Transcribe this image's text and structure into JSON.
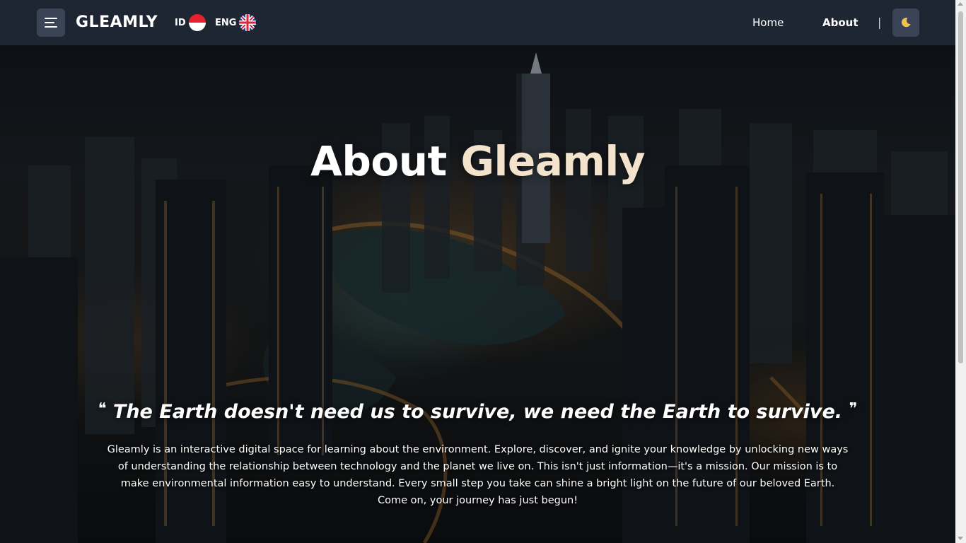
{
  "nav": {
    "brand": "GLEAMLY",
    "languages": [
      {
        "code": "ID",
        "flag": "indonesia-flag-icon"
      },
      {
        "code": "ENG",
        "flag": "uk-flag-icon"
      }
    ],
    "links": [
      {
        "label": "Home",
        "active": false
      },
      {
        "label": "About",
        "active": true
      }
    ],
    "separator": "|",
    "menu_icon": "hamburger-menu-icon",
    "theme_icon": "moon-icon"
  },
  "hero": {
    "title_main": "About",
    "title_accent": "Gleamly",
    "quote_open": "❝",
    "quote": "The Earth doesn't need us to survive, we need the Earth to survive.",
    "quote_close": "❞",
    "description": "Gleamly is an interactive digital space for learning about the environment. Explore, discover, and ignite your knowledge by unlocking new ways of understanding the relationship between technology and the planet we live on. This isn't just information—it's a mission. Our mission is to make environmental information easy to understand. Every small step you take can shine a bright light on the future of our beloved Earth. Come on, your journey has just begun!"
  },
  "colors": {
    "navbar_bg": "#1e2634",
    "button_bg": "#3a4456",
    "accent_title": "#f4e3cc",
    "flag_red": "#e7202e",
    "moon": "#f2c14e"
  }
}
